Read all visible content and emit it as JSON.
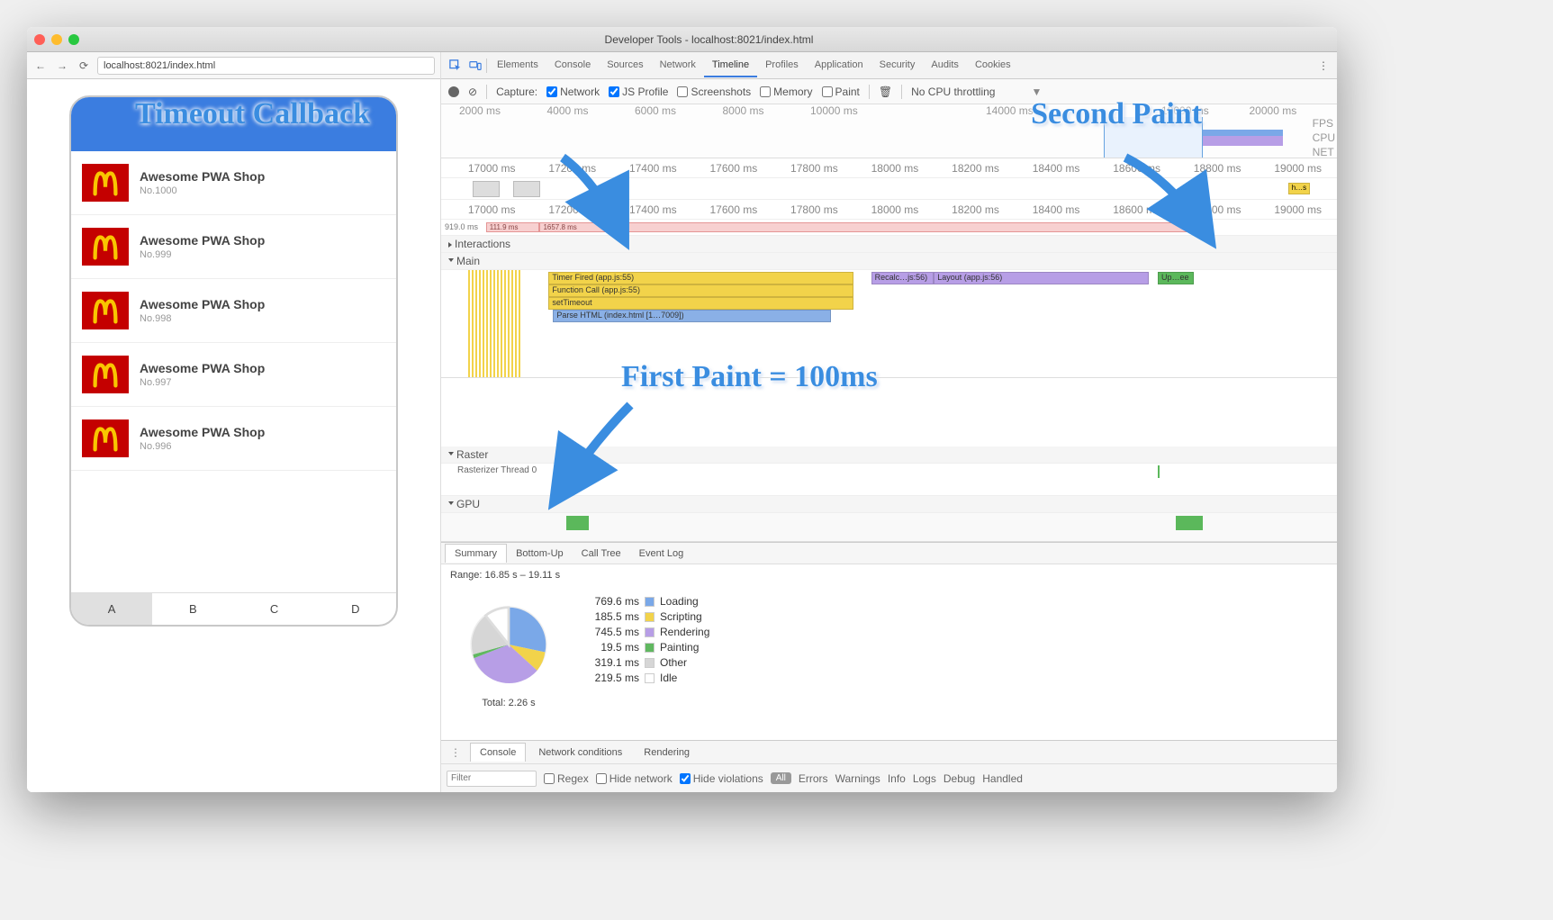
{
  "window": {
    "title": "Developer Tools - localhost:8021/index.html"
  },
  "browser": {
    "url": "localhost:8021/index.html"
  },
  "app": {
    "shops": [
      {
        "title": "Awesome PWA Shop",
        "sub": "No.1000"
      },
      {
        "title": "Awesome PWA Shop",
        "sub": "No.999"
      },
      {
        "title": "Awesome PWA Shop",
        "sub": "No.998"
      },
      {
        "title": "Awesome PWA Shop",
        "sub": "No.997"
      },
      {
        "title": "Awesome PWA Shop",
        "sub": "No.996"
      }
    ],
    "alpha_tabs": [
      "A",
      "B",
      "C",
      "D"
    ],
    "alpha_active": 0
  },
  "devtools": {
    "tabs": [
      "Elements",
      "Console",
      "Sources",
      "Network",
      "Timeline",
      "Profiles",
      "Application",
      "Security",
      "Audits",
      "Cookies"
    ],
    "active_tab": "Timeline",
    "capture_label": "Capture:",
    "capture_opts": {
      "network": {
        "label": "Network",
        "checked": true
      },
      "jsprofile": {
        "label": "JS Profile",
        "checked": true
      },
      "screenshots": {
        "label": "Screenshots",
        "checked": false
      },
      "memory": {
        "label": "Memory",
        "checked": false
      },
      "paint": {
        "label": "Paint",
        "checked": false
      }
    },
    "throttling_label": "No CPU throttling",
    "overview_ticks": [
      "2000 ms",
      "4000 ms",
      "6000 ms",
      "8000 ms",
      "10000 ms",
      "",
      "14000 ms",
      "",
      "18000 ms",
      "20000 ms"
    ],
    "overview_side": [
      "FPS",
      "CPU",
      "NET"
    ],
    "detail_ticks": [
      "17000 ms",
      "17200 ms",
      "17400 ms",
      "17600 ms",
      "17800 ms",
      "18000 ms",
      "18200 ms",
      "18400 ms",
      "18600 ms",
      "18800 ms",
      "19000 ms"
    ],
    "hs_label": "h…s",
    "net": {
      "left_time": "919.0 ms",
      "bar1": "111.9 ms",
      "bar2": "1657.8 ms"
    },
    "interactions_label": "Interactions",
    "main_label": "Main",
    "raster_label": "Raster",
    "raster_thread_label": "Rasterizer Thread 0",
    "gpu_label": "GPU",
    "flames": {
      "timer_fired": "Timer Fired (app.js:55)",
      "function_call": "Function Call (app.js:55)",
      "set_timeout": "setTimeout",
      "parse_html": "Parse HTML (index.html [1…7009])",
      "recalc": "Recalc…js:56)",
      "layout": "Layout (app.js:56)",
      "update": "Up…ee"
    },
    "summary": {
      "tabs": [
        "Summary",
        "Bottom-Up",
        "Call Tree",
        "Event Log"
      ],
      "range": "Range: 16.85 s – 19.11 s",
      "total": "Total: 2.26 s",
      "legend": [
        {
          "t": "769.6 ms",
          "l": "Loading",
          "c": "#7aa8e8"
        },
        {
          "t": "185.5 ms",
          "l": "Scripting",
          "c": "#f2d34a"
        },
        {
          "t": "745.5 ms",
          "l": "Rendering",
          "c": "#b79ee6"
        },
        {
          "t": "19.5 ms",
          "l": "Painting",
          "c": "#60b860"
        },
        {
          "t": "319.1 ms",
          "l": "Other",
          "c": "#d6d6d6"
        },
        {
          "t": "219.5 ms",
          "l": "Idle",
          "c": "#ffffff"
        }
      ]
    },
    "drawer": {
      "tabs": [
        "Console",
        "Network conditions",
        "Rendering"
      ],
      "filter_placeholder": "Filter",
      "regex": "Regex",
      "hide_network": "Hide network",
      "hide_violations": "Hide violations",
      "all": "All",
      "levels": [
        "Errors",
        "Warnings",
        "Info",
        "Logs",
        "Debug",
        "Handled"
      ]
    }
  },
  "annotations": {
    "timeout_cb": "Timeout Callback",
    "second_paint": "Second Paint",
    "first_paint": "First Paint = 100ms"
  }
}
